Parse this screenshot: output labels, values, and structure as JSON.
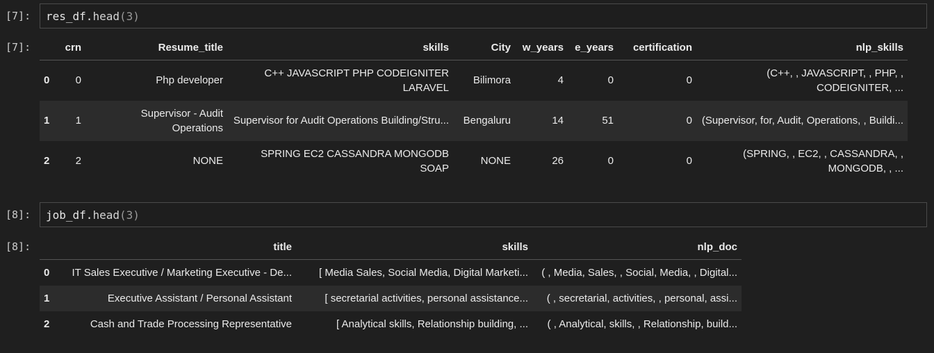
{
  "cells": [
    {
      "in_prompt": "[7]:",
      "code": {
        "obj": "res_df",
        "dot": ".",
        "method": "head",
        "open": "(",
        "arg": "3",
        "close": ")"
      },
      "out_prompt": "[7]:",
      "table": {
        "columns": [
          "",
          "crn",
          "Resume_title",
          "skills",
          "City",
          "w_years",
          "e_years",
          "certification",
          "nlp_skills"
        ],
        "rows": [
          [
            "0",
            "0",
            "Php developer",
            "C++ JAVASCRIPT PHP CODEIGNITER LARAVEL",
            "Bilimora",
            "4",
            "0",
            "0",
            "(C++, , JAVASCRIPT, , PHP, , CODEIGNITER, ..."
          ],
          [
            "1",
            "1",
            "Supervisor - Audit Operations",
            "Supervisor for Audit Operations Building/Stru...",
            "Bengaluru",
            "14",
            "51",
            "0",
            "(Supervisor, for, Audit, Operations, , Buildi..."
          ],
          [
            "2",
            "2",
            "NONE",
            "SPRING EC2 CASSANDRA MONGODB SOAP",
            "NONE",
            "26",
            "0",
            "0",
            "(SPRING, , EC2, , CASSANDRA, , MONGODB, , ..."
          ]
        ]
      }
    },
    {
      "in_prompt": "[8]:",
      "code": {
        "obj": "job_df",
        "dot": ".",
        "method": "head",
        "open": "(",
        "arg": "3",
        "close": ")"
      },
      "out_prompt": "[8]:",
      "table": {
        "columns": [
          "",
          "title",
          "skills",
          "nlp_doc"
        ],
        "rows": [
          [
            "0",
            "IT Sales Executive / Marketing Executive - De...",
            "[ Media Sales, Social Media, Digital Marketi...",
            "( , Media, Sales, , Social, Media, , Digital..."
          ],
          [
            "1",
            "Executive Assistant / Personal Assistant",
            "[ secretarial activities, personal assistance...",
            "( , secretarial, activities, , personal, assi..."
          ],
          [
            "2",
            "Cash and Trade Processing Representative",
            "[ Analytical skills, Relationship building, ...",
            "( , Analytical, skills, , Relationship, build..."
          ]
        ]
      }
    }
  ]
}
